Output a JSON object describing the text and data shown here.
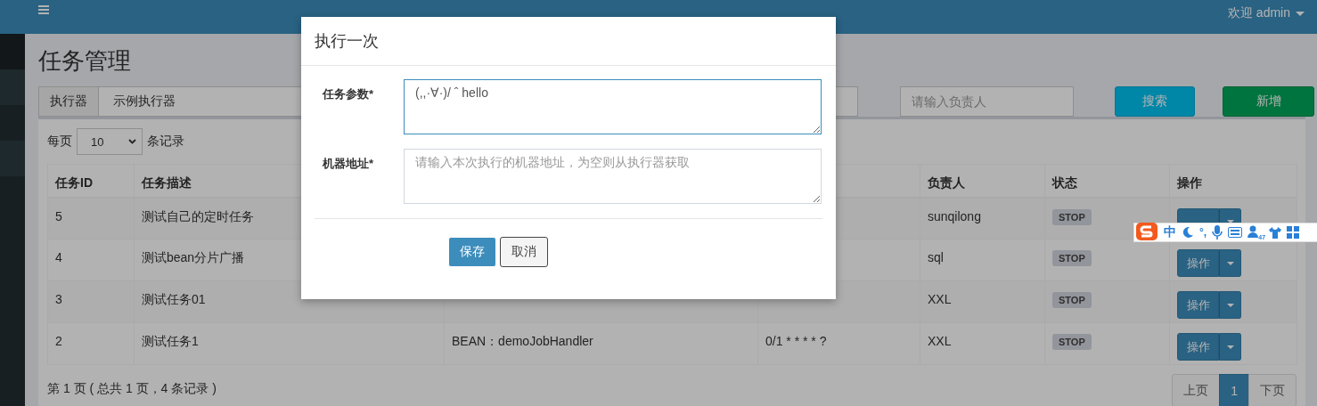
{
  "header": {
    "user": "欢迎 admin"
  },
  "page_title": "任务管理",
  "filters": {
    "executor_label": "执行器",
    "executor_value": "示例执行器",
    "owner_placeholder": "请输入负责人"
  },
  "filter_buttons": [
    {
      "label": "搜索",
      "kind": "info"
    },
    {
      "label": "新增",
      "kind": "success"
    }
  ],
  "page_size": {
    "prefix": "每页",
    "value": "10",
    "suffix": "条记录"
  },
  "table": {
    "columns_left": [
      "任务ID",
      "任务描述"
    ],
    "columns_right": [
      "负责人",
      "状态",
      "操作"
    ],
    "rows": [
      {
        "id": "5",
        "description": "测试自己的定时任务",
        "owner": "sunqilong",
        "status": "STOP"
      },
      {
        "id": "4",
        "description": "测试bean分片广播",
        "owner": "sql",
        "status": "STOP",
        "action": "操作"
      },
      {
        "id": "3",
        "description": "测试任务01",
        "owner": "XXL",
        "status": "STOP",
        "action": "操作"
      },
      {
        "id": "2",
        "description": "测试任务1",
        "column_3": "BEAN：demoJobHandler",
        "column_4": "0/1 * * * * ?",
        "owner": "XXL",
        "status": "STOP",
        "action": "操作"
      }
    ]
  },
  "pagination": {
    "summary": "第 1 页 ( 总共 1 页，4 条记录 )",
    "pages": [
      {
        "label": "上页",
        "selected": false
      },
      {
        "label": "1",
        "selected": true
      },
      {
        "label": "下页",
        "selected": false
      }
    ]
  },
  "modal": {
    "title": "执行一次",
    "fields": [
      {
        "label": "任务参数*",
        "value": "(,,·∀·)/ ˆ hello",
        "focused": true
      },
      {
        "label": "机器地址*",
        "placeholder": "请输入本次执行的机器地址，为空则从执行器获取",
        "focused": false
      }
    ],
    "buttons": [
      {
        "label": "保存",
        "kind": "primary"
      },
      {
        "label": "取消",
        "kind": "default"
      }
    ]
  },
  "ime": {
    "mode": "中",
    "punct": "°,",
    "badge": "47"
  }
}
